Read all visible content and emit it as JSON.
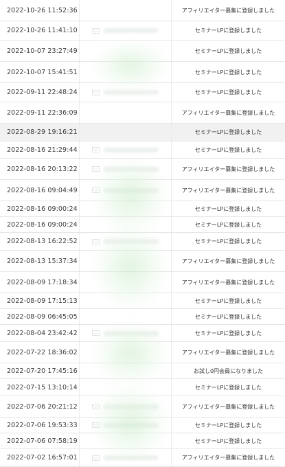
{
  "rows": [
    {
      "date": "2022-10-26 11:52:36",
      "action": "アフィリエイター募集に登録しました",
      "mail": false
    },
    {
      "date": "2022-10-26 11:41:10",
      "action": "セミナーLPに登録しました",
      "mail": true
    },
    {
      "date": "2022-10-07 23:27:49",
      "action": "セミナーLPに登録しました",
      "mail": false
    },
    {
      "date": "2022-10-07 15:41:51",
      "action": "セミナーLPに登録しました",
      "mail": false
    },
    {
      "date": "2022-09-11 22:48:24",
      "action": "セミナーLPに登録しました",
      "mail": true
    },
    {
      "date": "2022-09-11 22:36:09",
      "action": "アフィリエイター募集に登録しました",
      "mail": false
    },
    {
      "date": "2022-08-29 19:16:21",
      "action": "セミナーLPに登録しました",
      "mail": false
    },
    {
      "date": "2022-08-16 21:29:44",
      "action": "セミナーLPに登録しました",
      "mail": true
    },
    {
      "date": "2022-08-16 20:13:22",
      "action": "アフィリエイター募集に登録しました",
      "mail": true
    },
    {
      "date": "2022-08-16 09:04:49",
      "action": "アフィリエイター募集に登録しました",
      "mail": true
    },
    {
      "date": "2022-08-16 09:00:24",
      "action": "セミナーLPに登録しました",
      "mail": false
    },
    {
      "date": "2022-08-16 09:00:24",
      "action": "セミナーLPに登録しました",
      "mail": false
    },
    {
      "date": "2022-08-13 16:22:52",
      "action": "セミナーLPに登録しました",
      "mail": true
    },
    {
      "date": "2022-08-13 15:37:34",
      "action": "アフィリエイター募集に登録しました",
      "mail": false
    },
    {
      "date": "2022-08-09 17:18:34",
      "action": "アフィリエイター募集に登録しました",
      "mail": false
    },
    {
      "date": "2022-08-09 17:15:13",
      "action": "セミナーLPに登録しました",
      "mail": false
    },
    {
      "date": "2022-08-09 06:45:05",
      "action": "セミナーLPに登録しました",
      "mail": false
    },
    {
      "date": "2022-08-04 23:42:42",
      "action": "セミナーLPに登録しました",
      "mail": true
    },
    {
      "date": "2022-07-22 18:36:02",
      "action": "アフィリエイター募集に登録しました",
      "mail": false
    },
    {
      "date": "2022-07-20 17:45:16",
      "action": "お試し0円会員になりました",
      "mail": false
    },
    {
      "date": "2022-07-15 13:10:14",
      "action": "セミナーLPに登録しました",
      "mail": false
    },
    {
      "date": "2022-07-06 20:21:12",
      "action": "アフィリエイター募集に登録しました",
      "mail": true
    },
    {
      "date": "2022-07-06 19:53:33",
      "action": "セミナーLPに登録しました",
      "mail": true
    },
    {
      "date": "2022-07-06 07:58:19",
      "action": "セミナーLPに登録しました",
      "mail": false
    },
    {
      "date": "2022-07-02 16:57:01",
      "action": "アフィリエイター募集に登録しました",
      "mail": true
    }
  ],
  "highlighted_row": 6,
  "colors": {
    "border": "#e6e6e6",
    "highlight": "#f1f1f1",
    "text": "#333333"
  }
}
